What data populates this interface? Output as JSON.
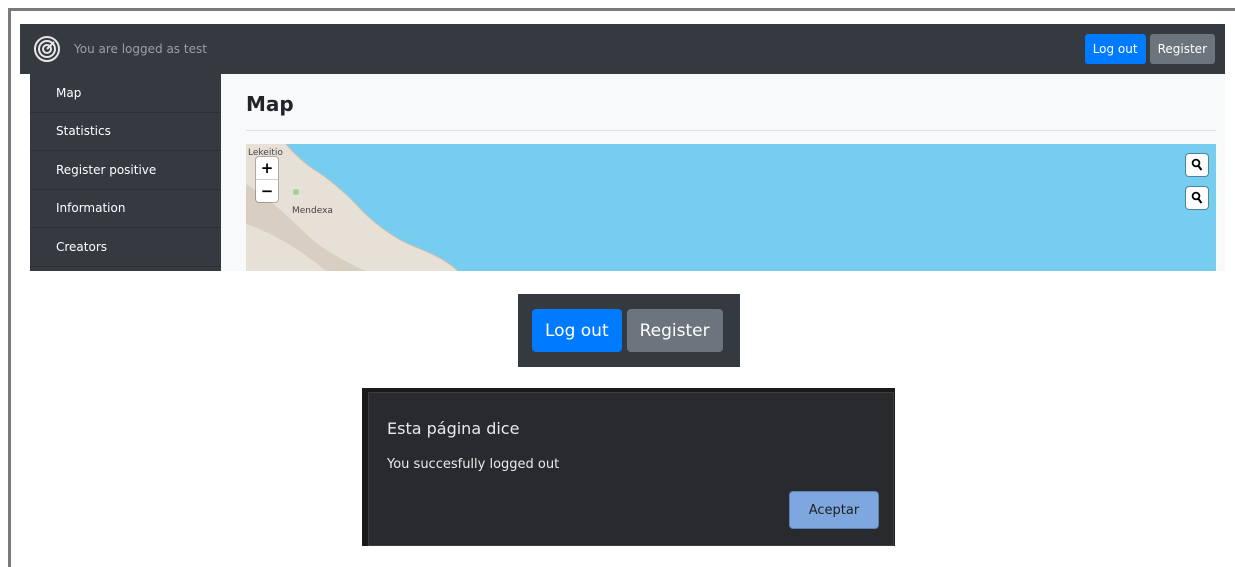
{
  "navbar": {
    "logged_text": "You are logged as test",
    "logout_label": "Log out",
    "register_label": "Register",
    "logo_icon": "radar-icon"
  },
  "sidebar": {
    "items": [
      {
        "label": "Map"
      },
      {
        "label": "Statistics"
      },
      {
        "label": "Register positive"
      },
      {
        "label": "Information"
      },
      {
        "label": "Creators"
      }
    ]
  },
  "main": {
    "title": "Map"
  },
  "map": {
    "zoom_in": "+",
    "zoom_out": "−",
    "town_label": "Mendexa",
    "corner_label": "Lekeitio",
    "search_icons": [
      "search-icon",
      "search-icon"
    ],
    "sea_color": "#76cdef",
    "land_color": "#e7e0d6"
  },
  "button_crop": {
    "logout_label": "Log out",
    "register_label": "Register"
  },
  "dialog": {
    "title": "Esta página dice",
    "message": "You succesfully logged out",
    "ok_label": "Aceptar"
  },
  "colors": {
    "navbar_bg": "#343a40",
    "primary": "#007bff",
    "secondary": "#6c757d",
    "dialog_bg": "#292a2d",
    "dialog_button": "#7ea6df"
  }
}
